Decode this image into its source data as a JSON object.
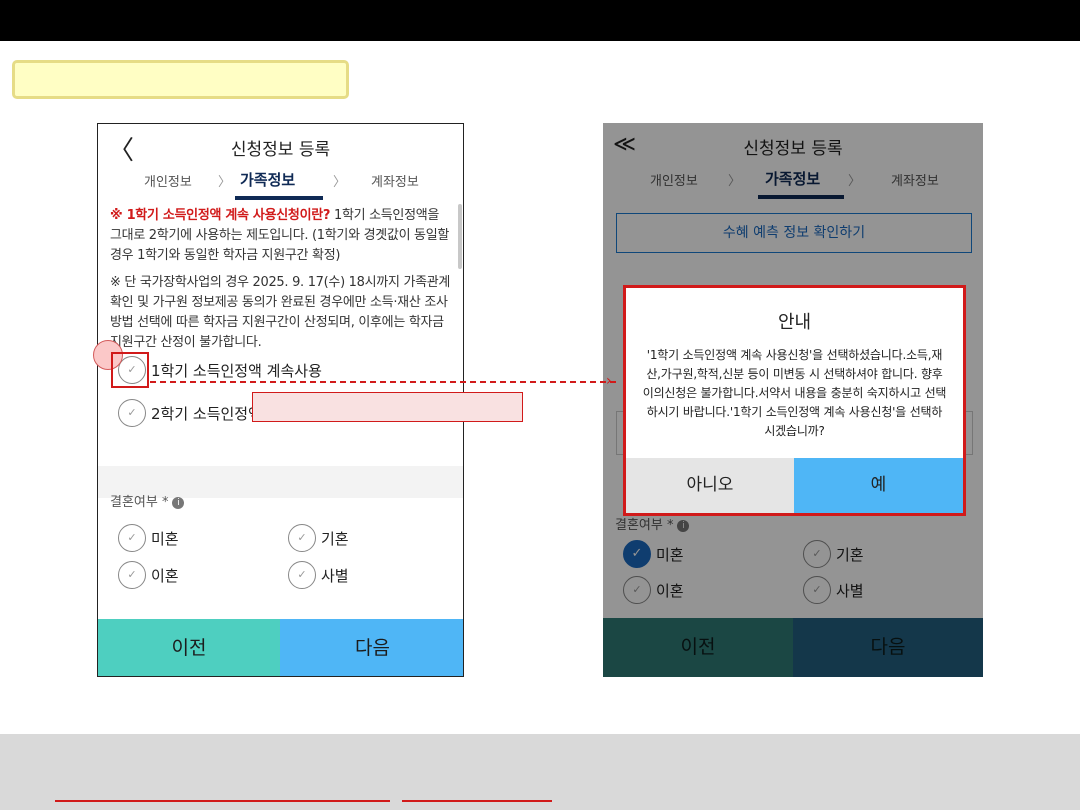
{
  "left_phone": {
    "back_icon": "chevron-left-icon",
    "back_glyph": "〈",
    "title": "신청정보 등록",
    "steps": [
      "개인정보",
      "가족정보",
      "계좌정보"
    ],
    "chevron_glyph": "〉",
    "notice": {
      "p1_red": "※ 1학기 소득인정액 계속 사용신청이란?",
      "p1_rest": " 1학기 소득인정액을 그대로 2학기에 사용하는 제도입니다. (1학기와 경곗값이 동일할 경우 1학기와 동일한 학자금 지원구간 확정)",
      "p2": "※ 단 국가장학사업의 경우 2025. 9. 17(수) 18시까지 가족관계 확인 및 가구원 정보제공 동의가 완료된 경우에만 소득·재산 조사 방법 선택에 따른 학자금 지원구간이 산정되며, 이후에는 학자금 지원구간 산정이 불가합니다."
    },
    "options": [
      "1학기 소득인정액 계속사용",
      "2학기 소득인정액"
    ],
    "marital_label": "결혼여부",
    "required_mark": " *",
    "info_glyph": "i",
    "marital_options": [
      "미혼",
      "기혼",
      "이혼",
      "사별"
    ],
    "check_glyph": "✓",
    "prev_label": "이전",
    "next_label": "다음"
  },
  "right_phone": {
    "back_glyph": "≪",
    "title": "신청정보 등록",
    "steps": [
      "개인정보",
      "가족정보",
      "계좌정보"
    ],
    "chevron_glyph": "〉",
    "verify_button": "수혜 예측 정보 확인하기",
    "marital_label": "결혼여부",
    "required_mark": " *",
    "info_glyph": "i",
    "marital_options": [
      "미혼",
      "기혼",
      "이혼",
      "사별"
    ],
    "check_glyph": "✓",
    "prev_label": "이전",
    "next_label": "다음"
  },
  "modal": {
    "title": "안내",
    "body": "'1학기 소득인정액 계속 사용신청'을 선택하셨습니다.소득,재산,가구원,학적,신분 등이 미변동 시 선택하셔야 합니다. 향후 이의신청은 불가합니다.서약서 내용을 충분히 숙지하시고 선택하시기 바랍니다.'1학기 소득인정액 계속 사용신청'을 선택하시겠습니까?",
    "no_label": "아니오",
    "yes_label": "예"
  },
  "annotation": {
    "arrow_glyph": "›",
    "accent_color": "#d11a1a"
  }
}
